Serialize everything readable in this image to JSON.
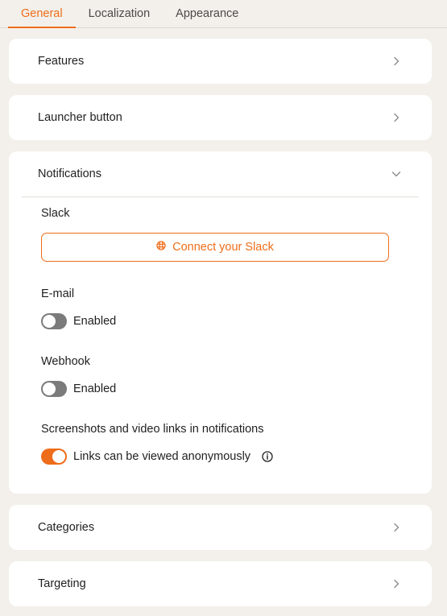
{
  "tabs": [
    {
      "label": "General",
      "active": true
    },
    {
      "label": "Localization",
      "active": false
    },
    {
      "label": "Appearance",
      "active": false
    }
  ],
  "cards": {
    "features": {
      "title": "Features"
    },
    "launcher": {
      "title": "Launcher button"
    },
    "notifications": {
      "title": "Notifications",
      "slack": {
        "label": "Slack",
        "button_label": "Connect your Slack",
        "icon": "slack-icon"
      },
      "email": {
        "label": "E-mail",
        "toggle_label": "Enabled",
        "enabled": false
      },
      "webhook": {
        "label": "Webhook",
        "toggle_label": "Enabled",
        "enabled": false
      },
      "screenshots": {
        "label": "Screenshots and video links in notifications",
        "toggle_label": "Links can be viewed anonymously",
        "enabled": true,
        "icon": "info-icon"
      }
    },
    "categories": {
      "title": "Categories"
    },
    "targeting": {
      "title": "Targeting"
    }
  },
  "colors": {
    "accent": "#ee6d1a",
    "background": "#f3f0eb",
    "card": "#ffffff",
    "toggle_off": "#7b7b7b"
  }
}
